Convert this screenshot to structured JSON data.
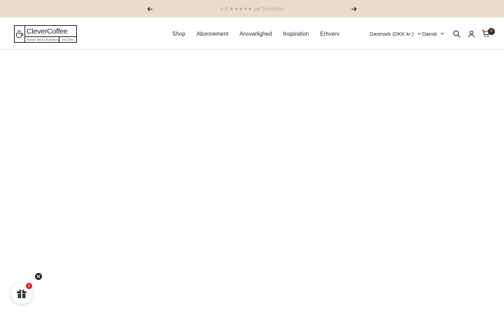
{
  "announcement": {
    "text": "4.6 ★★★★★ på Trustpilot",
    "prev_icon": "arrow-left-icon",
    "next_icon": "arrow-right-icon"
  },
  "logo": {
    "name": "CleverCoffee",
    "tagline": "Nordic Micro Roasters",
    "est": "Est. 2014"
  },
  "nav": {
    "items": [
      {
        "label": "Shop"
      },
      {
        "label": "Abonnement"
      },
      {
        "label": "Ansvarlighed"
      },
      {
        "label": "Inspiration"
      },
      {
        "label": "Erhverv"
      }
    ]
  },
  "locale": {
    "country": "Danmark (DKK kr.)",
    "language": "Dansk"
  },
  "cart": {
    "count": "0"
  },
  "gift_widget": {
    "badge": "1"
  },
  "colors": {
    "announcement_bg": "#e8dccb",
    "text": "#3a2a22",
    "badge_red": "#d7262b"
  }
}
